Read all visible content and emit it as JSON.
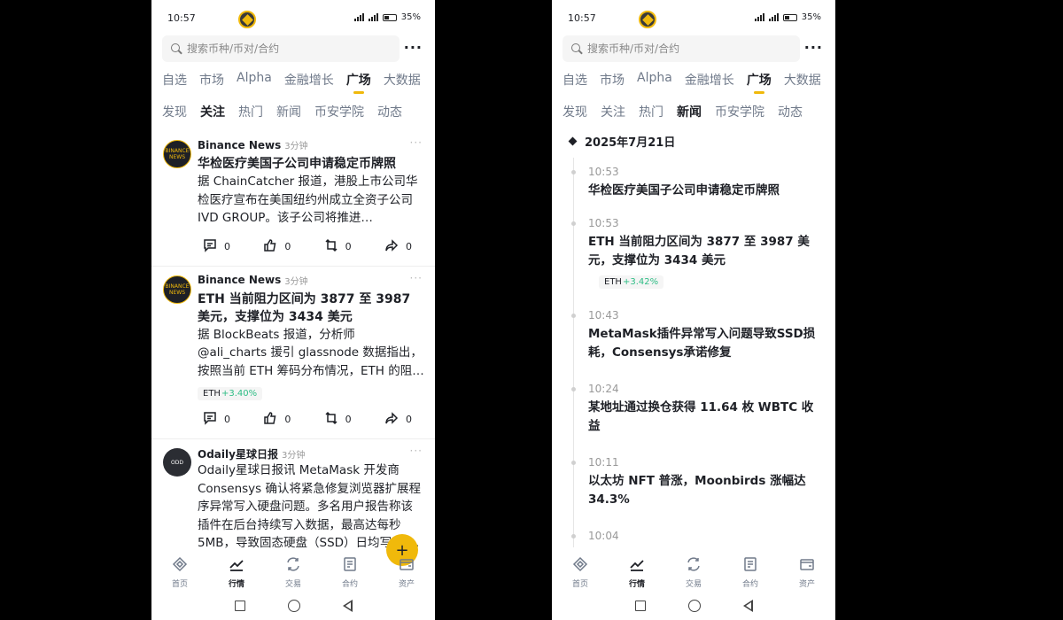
{
  "status": {
    "time": "10:57",
    "battery": "35%",
    "network": "4G"
  },
  "search": {
    "placeholder": "搜索币种/币对/合约"
  },
  "tabs_primary": [
    "自选",
    "市场",
    "Alpha",
    "金融增长",
    "广场",
    "大数据"
  ],
  "active_primary": "广场",
  "tabs_secondary": [
    "发现",
    "关注",
    "热门",
    "新闻",
    "币安学院",
    "动态"
  ],
  "left": {
    "active_secondary": "关注",
    "posts": [
      {
        "author": "Binance News",
        "ago": "3分钟",
        "avatar_text": "BINANCE NEWS",
        "title": "华检医疗美国子公司申请稳定币牌照",
        "body": "据 ChainCatcher 报道，港股上市公司华检医疗宣布在美国纽约州成立全资子公司 IVD GROUP。该子公司将推进 IVDNews…",
        "tag": null,
        "counts": {
          "comments": "0",
          "likes": "0",
          "reposts": "0",
          "shares": "0"
        }
      },
      {
        "author": "Binance News",
        "ago": "3分钟",
        "avatar_text": "BINANCE NEWS",
        "title": "ETH 当前阻力区间为 3877 至 3987 美元，支撑位为 3434 美元",
        "body": "据 BlockBeats 报道，分析师 @ali_charts 援引 glassnode 数据指出，按照当前 ETH 筹码分布情况，ETH 的阻力区间为 387…",
        "tag": {
          "symbol": "ETH",
          "change": "+3.40%"
        },
        "counts": {
          "comments": "0",
          "likes": "0",
          "reposts": "0",
          "shares": "0"
        }
      },
      {
        "author": "Odaily星球日报",
        "ago": "3分钟",
        "avatar_text": "ODD",
        "title": "",
        "body": "Odaily星球日报讯 MetaMask 开发商 Consensys 确认将紧急修复浏览器扩展程序异常写入硬盘问题。多名用户报告称该插件在后台持续写入数据，最高达每秒 5MB，导致固态硬盘（SSD）日均写入 …",
        "tag": null,
        "counts": {
          "comments": "0",
          "likes": "0",
          "reposts": "0",
          "shares": "0"
        }
      }
    ]
  },
  "right": {
    "active_secondary": "新闻",
    "date": "2025年7月21日",
    "items": [
      {
        "time": "10:53",
        "headline": "华检医疗美国子公司申请稳定币牌照",
        "tag": null
      },
      {
        "time": "10:53",
        "headline": "ETH 当前阻力区间为 3877 至 3987 美元，支撑位为 3434 美元",
        "tag": {
          "symbol": "ETH",
          "change": "+3.42%"
        }
      },
      {
        "time": "10:43",
        "headline": "MetaMask插件异常写入问题导致SSD损耗，Consensys承诺修复",
        "tag": null
      },
      {
        "time": "10:24",
        "headline": "某地址通过换仓获得 11.64 枚 WBTC 收益",
        "tag": null
      },
      {
        "time": "10:11",
        "headline": "以太坊 NFT 普涨，Moonbirds 涨幅达 34.3%",
        "tag": null
      },
      {
        "time": "10:04",
        "headline": "",
        "tag": null
      }
    ]
  },
  "bottom_nav": [
    {
      "label": "首页",
      "icon": "home-icon"
    },
    {
      "label": "行情",
      "icon": "markets-icon"
    },
    {
      "label": "交易",
      "icon": "trade-icon"
    },
    {
      "label": "合约",
      "icon": "futures-icon"
    },
    {
      "label": "资产",
      "icon": "wallet-icon"
    }
  ],
  "active_bottom": "行情",
  "fab_label": "+",
  "colors": {
    "accent": "#f0b90b",
    "up": "#2ebd85",
    "text": "#1e2026",
    "muted": "#707a8a"
  }
}
